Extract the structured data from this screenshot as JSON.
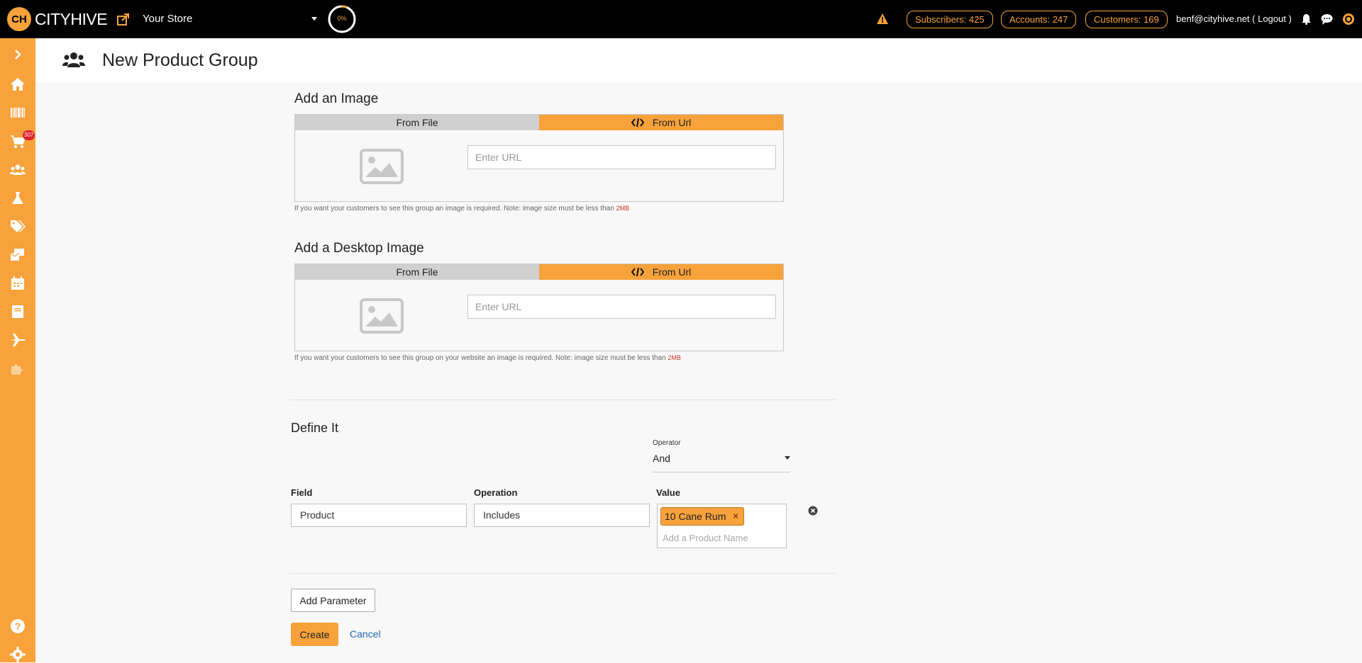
{
  "topbar": {
    "logo_text": "CITYHIVE",
    "logo_mark": "CH",
    "store_name": "Your Store",
    "progress": "0%",
    "subscribers": "Subscribers: 425",
    "accounts": "Accounts: 247",
    "customers": "Customers: 169",
    "user": "benf@cityhive.net ( Logout )"
  },
  "sidebar": {
    "cart_badge": "307",
    "items": [
      "chevron-right-icon",
      "home-icon",
      "barcode-icon",
      "cart-icon",
      "users-icon",
      "flask-icon",
      "tags-icon",
      "mail-icon",
      "calendar-icon",
      "book-icon",
      "plane-icon",
      "puzzle-icon",
      "help-icon",
      "gear-icon"
    ]
  },
  "page": {
    "title": "New Product Group"
  },
  "image_section": {
    "title": "Add an Image",
    "tab_file": "From File",
    "tab_url": "From Url",
    "url_placeholder": "Enter URL",
    "note": "If you want your customers to see this group an image is required. Note: image size must be less than ",
    "note_size": "2MB"
  },
  "desktop_section": {
    "title": "Add a Desktop Image",
    "tab_file": "From File",
    "tab_url": "From Url",
    "url_placeholder": "Enter URL",
    "note": "If you want your customers to see this group on your website an image is required. Note: image size must be less than ",
    "note_size": "2MB"
  },
  "define": {
    "title": "Define It",
    "operator_label": "Operator",
    "operator_value": "And",
    "field_label": "Field",
    "field_value": "Product",
    "operation_label": "Operation",
    "operation_value": "Includes",
    "value_label": "Value",
    "value_tag": "10 Cane Rum",
    "value_tag_remove": "×",
    "value_placeholder": "Add a Product Name"
  },
  "actions": {
    "add_parameter": "Add Parameter",
    "create": "Create",
    "cancel": "Cancel"
  },
  "colors": {
    "accent": "#f7a23b",
    "topbar": "#000000",
    "link": "#2469b3"
  }
}
